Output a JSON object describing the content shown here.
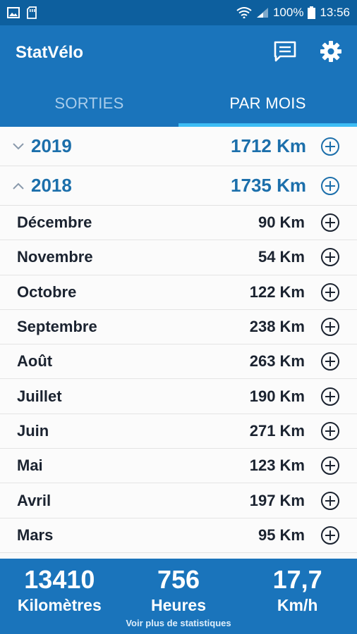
{
  "status_bar": {
    "battery": "100%",
    "time": "13:56",
    "icons": [
      "image-icon",
      "sd-card-icon",
      "wifi-icon",
      "signal-icon",
      "battery-icon"
    ]
  },
  "app": {
    "title": "StatVélo",
    "actions": [
      "chat-icon",
      "gear-icon"
    ]
  },
  "tabs": [
    {
      "label": "SORTIES",
      "active": false
    },
    {
      "label": "PAR MOIS",
      "active": true
    }
  ],
  "years": [
    {
      "year": "2019",
      "distance": "1712 Km",
      "expanded": false
    },
    {
      "year": "2018",
      "distance": "1735 Km",
      "expanded": true
    }
  ],
  "months": [
    {
      "month": "Décembre",
      "distance": "90 Km"
    },
    {
      "month": "Novembre",
      "distance": "54 Km"
    },
    {
      "month": "Octobre",
      "distance": "122 Km"
    },
    {
      "month": "Septembre",
      "distance": "238 Km"
    },
    {
      "month": "Août",
      "distance": "263 Km"
    },
    {
      "month": "Juillet",
      "distance": "190 Km"
    },
    {
      "month": "Juin",
      "distance": "271 Km"
    },
    {
      "month": "Mai",
      "distance": "123 Km"
    },
    {
      "month": "Avril",
      "distance": "197 Km"
    },
    {
      "month": "Mars",
      "distance": "95 Km"
    }
  ],
  "footer": {
    "stats": [
      {
        "value": "13410",
        "label": "Kilomètres"
      },
      {
        "value": "756",
        "label": "Heures"
      },
      {
        "value": "17,7",
        "label": "Km/h"
      }
    ],
    "more_link": "Voir plus de statistiques"
  },
  "colors": {
    "status_bar": "#0d5f9e",
    "primary": "#1a74bb",
    "tab_indicator": "#3dbdf5",
    "year_text": "#1c6fab"
  }
}
